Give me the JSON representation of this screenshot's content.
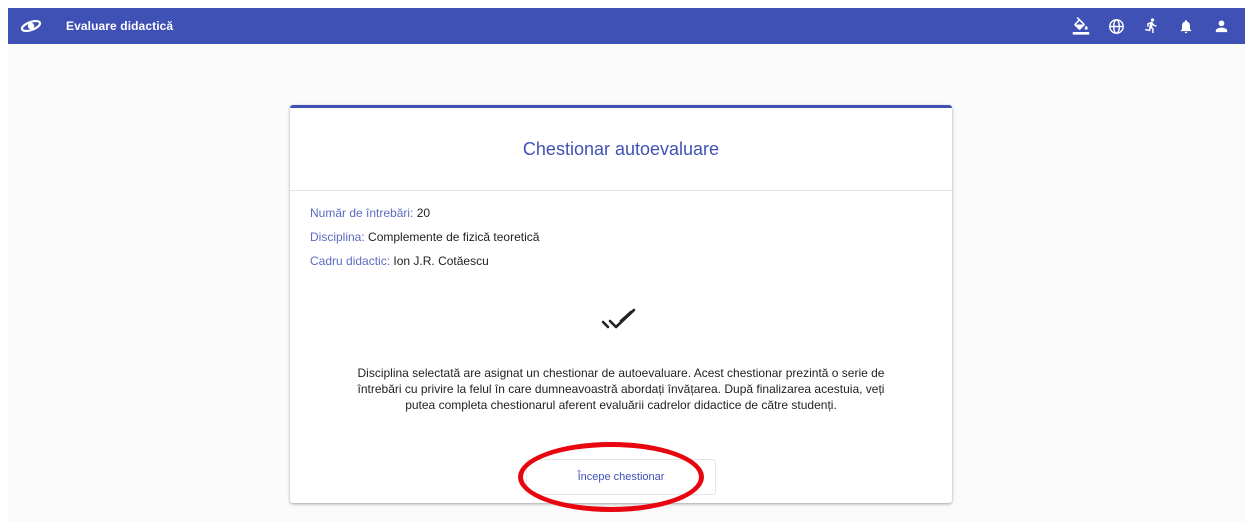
{
  "app": {
    "title": "Evaluare didactică"
  },
  "topbar": {
    "icons": [
      "paint-bucket-icon",
      "globe-icon",
      "accessibility-icon",
      "notifications-icon",
      "account-icon"
    ],
    "color": "#3f51b5"
  },
  "card": {
    "title": "Chestionar autoevaluare",
    "meta": {
      "questions_label": "Număr de întrebări:",
      "questions_value": "20",
      "discipline_label": "Disciplina:",
      "discipline_value": "Complemente de fizică teoretică",
      "teacher_label": "Cadru didactic:",
      "teacher_value": "Ion J.R. Cotăescu"
    },
    "description_line1": "Disciplina selectată are asignat un chestionar de autoevaluare. Acest chestionar prezintă o serie de",
    "description_line2": "întrebări cu privire la felul în care dumneavoastră abordați învățarea. După finalizarea acestuia, veți",
    "description_line3": "putea completa chestionarul aferent evaluării cadrelor didactice de către studenți.",
    "start_button": "Începe chestionar"
  },
  "annotation": {
    "highlight_color": "#e8050f"
  }
}
